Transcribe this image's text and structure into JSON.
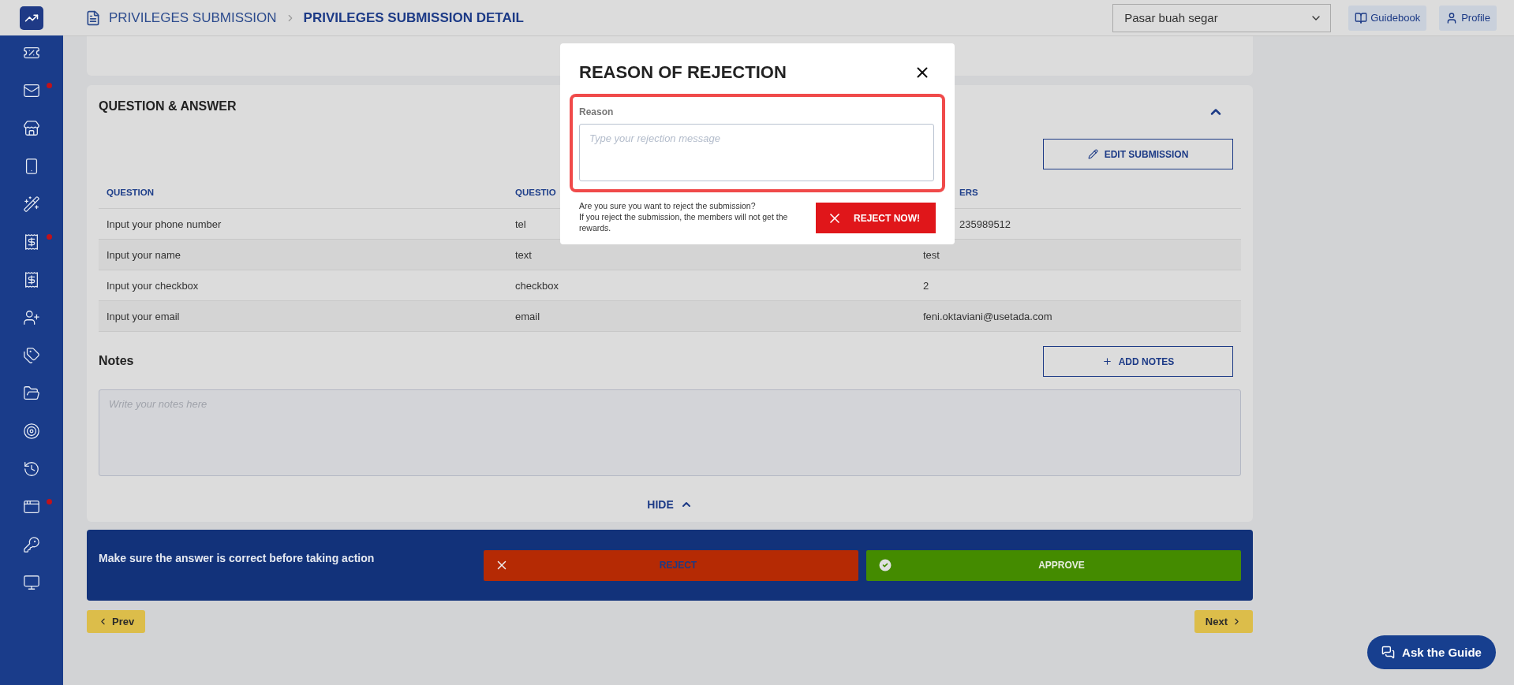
{
  "sidebar": {
    "items": [
      {
        "kind": "voucher",
        "badge": false
      },
      {
        "kind": "mail",
        "badge": true
      },
      {
        "kind": "store",
        "badge": false
      },
      {
        "kind": "menu",
        "badge": false
      },
      {
        "kind": "wand",
        "badge": false
      },
      {
        "kind": "atm",
        "badge": true
      },
      {
        "kind": "atm",
        "badge": false
      },
      {
        "kind": "user-add",
        "badge": false
      },
      {
        "kind": "tags",
        "badge": false
      },
      {
        "kind": "folder",
        "badge": false
      },
      {
        "kind": "target",
        "badge": false
      },
      {
        "kind": "history",
        "badge": false
      },
      {
        "kind": "settings-window",
        "badge": true
      },
      {
        "kind": "key",
        "badge": false
      },
      {
        "kind": "monitor",
        "badge": false
      }
    ]
  },
  "header": {
    "breadcrumb": [
      "PRIVILEGES SUBMISSION",
      "PRIVILEGES SUBMISSION DETAIL"
    ],
    "store_select": {
      "value": "Pasar buah segar"
    },
    "buttons": [
      {
        "kind": "book",
        "label": "Guidebook"
      },
      {
        "kind": "user",
        "label": "Profile"
      }
    ]
  },
  "qa": {
    "title": "QUESTION & ANSWER",
    "expanded": true,
    "edit_button": "EDIT SUBMISSION",
    "columns": [
      {
        "label": "QUESTION",
        "kind": "full"
      },
      {
        "label": "QUESTIO",
        "kind": "full"
      },
      {
        "label": "ERS",
        "kind": "partly_hidden"
      }
    ],
    "rows": [
      [
        {
          "text": "Input your phone number",
          "kind": "full"
        },
        {
          "text": "tel",
          "kind": "full"
        },
        {
          "text": "235989512",
          "kind": "partly_hidden"
        }
      ],
      [
        {
          "text": "Input your name",
          "kind": "full"
        },
        {
          "text": "text",
          "kind": "full"
        },
        {
          "text": "test",
          "kind": "full"
        }
      ],
      [
        {
          "text": "Input your checkbox",
          "kind": "full"
        },
        {
          "text": "checkbox",
          "kind": "full"
        },
        {
          "text": "2",
          "kind": "full"
        }
      ],
      [
        {
          "text": "Input your email",
          "kind": "full"
        },
        {
          "text": "email",
          "kind": "full"
        },
        {
          "text": "feni.oktaviani@usetada.com",
          "kind": "full"
        }
      ]
    ]
  },
  "notes": {
    "title": "Notes",
    "add_button": "ADD NOTES",
    "placeholder": "Write your notes here"
  },
  "hide_link": "HIDE",
  "action_bar": {
    "message": "Make sure the answer is correct before taking action",
    "reject": "REJECT",
    "approve": "APPROVE"
  },
  "pagination": {
    "prev": "Prev",
    "next": "Next"
  },
  "help_button": "Ask the Guide",
  "modal": {
    "title": "REASON OF REJECTION",
    "field": {
      "label": "Reason",
      "placeholder": "Type your rejection message",
      "highlighted": true
    },
    "warning": [
      "Are you sure you want to reject the submission?",
      "If you reject the submission, the members will not get the rewards."
    ],
    "confirm_button": "REJECT NOW!"
  }
}
